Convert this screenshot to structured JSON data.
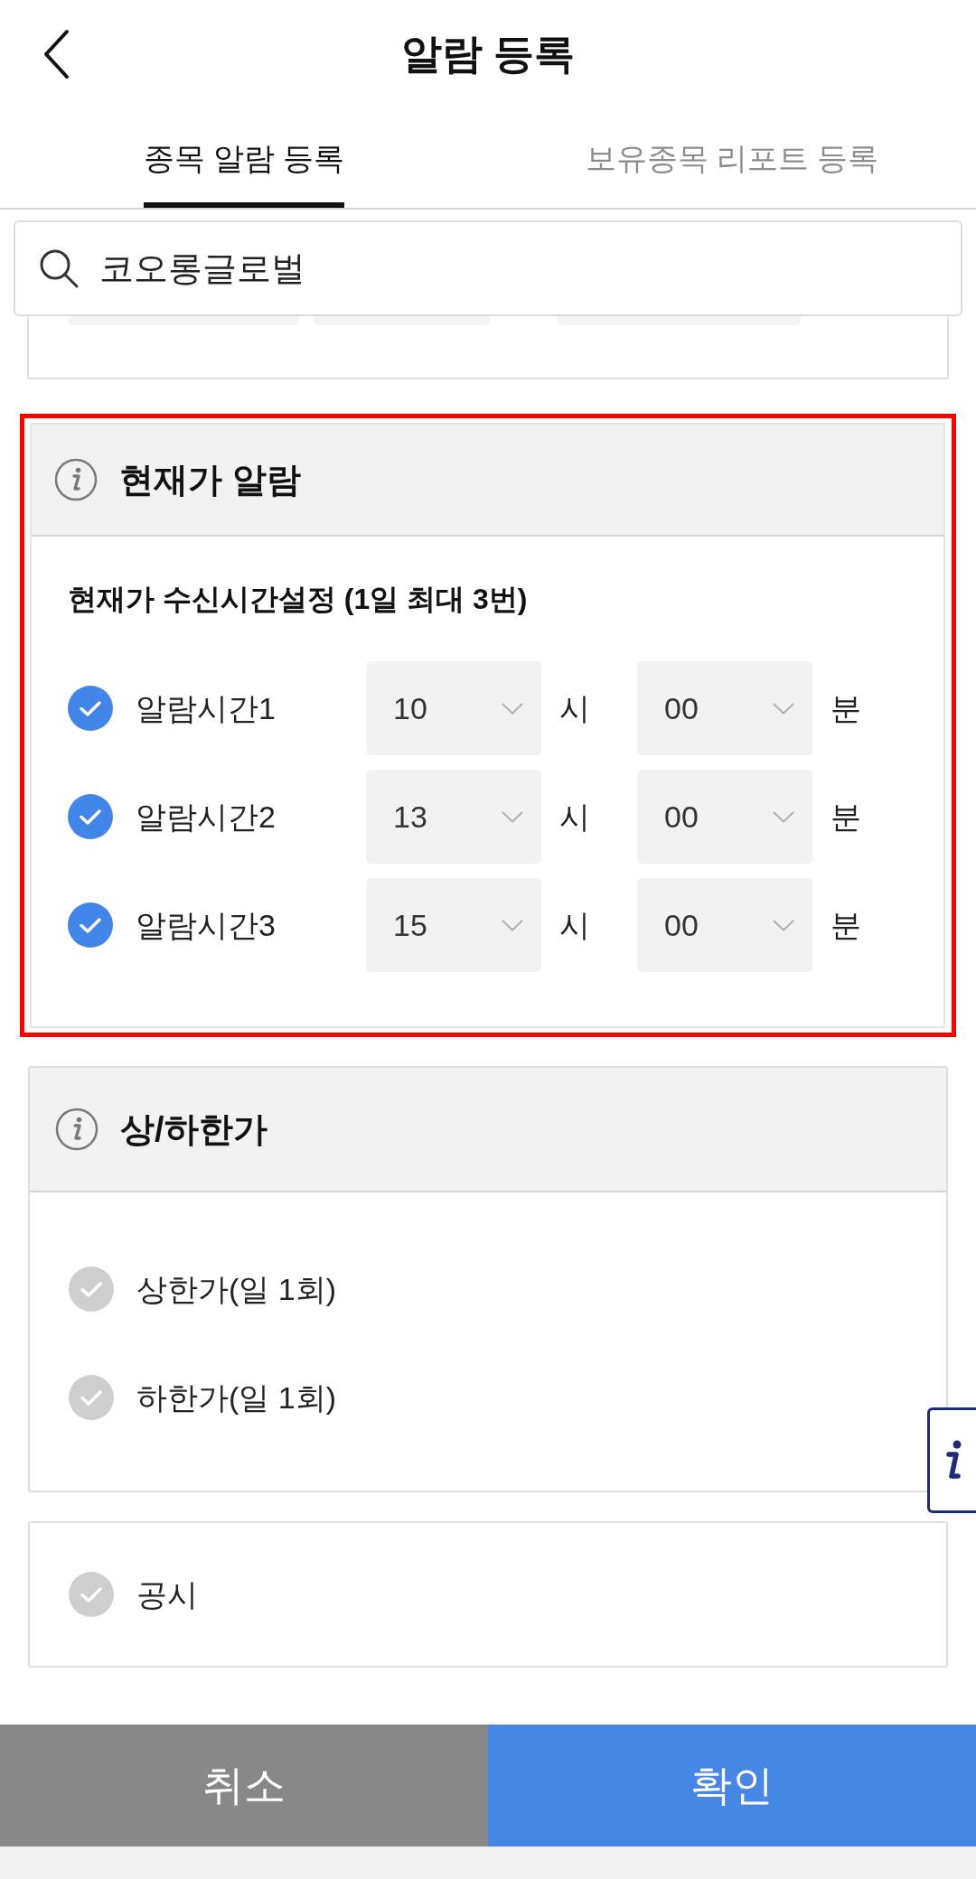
{
  "header": {
    "title": "알람 등록"
  },
  "tabs": [
    {
      "label": "종목 알람 등록",
      "selected": true
    },
    {
      "label": "보유종목 리포트 등록",
      "selected": false
    }
  ],
  "search": {
    "value": "코오롱글로벌"
  },
  "sections": [
    {
      "kind": "time_alarm",
      "title": "현재가 알람",
      "highlighted": true,
      "subtitle": "현재가 수신시간설정 (1일 최대 3번)",
      "rows": [
        {
          "label": "알람시간1",
          "checked": true,
          "hour": "10",
          "hour_unit": "시",
          "minute": "00",
          "minute_unit": "분"
        },
        {
          "label": "알람시간2",
          "checked": true,
          "hour": "13",
          "hour_unit": "시",
          "minute": "00",
          "minute_unit": "분"
        },
        {
          "label": "알람시간3",
          "checked": true,
          "hour": "15",
          "hour_unit": "시",
          "minute": "00",
          "minute_unit": "분"
        }
      ]
    },
    {
      "kind": "toggle_list",
      "title": "상/하한가",
      "highlighted": false,
      "rows": [
        {
          "label": "상한가(일 1회)",
          "checked": false
        },
        {
          "label": "하한가(일 1회)",
          "checked": false
        }
      ]
    },
    {
      "kind": "toggle_list",
      "highlighted": false,
      "rows": [
        {
          "label": "공시",
          "checked": false
        }
      ]
    }
  ],
  "buttons": [
    {
      "kind": "cancel",
      "label": "취소"
    },
    {
      "kind": "confirm",
      "label": "확인"
    }
  ]
}
